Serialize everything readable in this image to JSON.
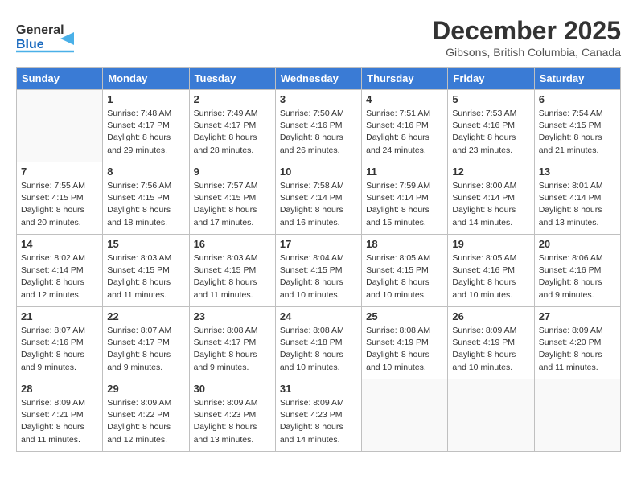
{
  "header": {
    "logo": {
      "line1": "General",
      "line2": "Blue"
    },
    "title": "December 2025",
    "subtitle": "Gibsons, British Columbia, Canada"
  },
  "weekdays": [
    "Sunday",
    "Monday",
    "Tuesday",
    "Wednesday",
    "Thursday",
    "Friday",
    "Saturday"
  ],
  "weeks": [
    [
      {
        "day": "",
        "info": ""
      },
      {
        "day": "1",
        "info": "Sunrise: 7:48 AM\nSunset: 4:17 PM\nDaylight: 8 hours\nand 29 minutes."
      },
      {
        "day": "2",
        "info": "Sunrise: 7:49 AM\nSunset: 4:17 PM\nDaylight: 8 hours\nand 28 minutes."
      },
      {
        "day": "3",
        "info": "Sunrise: 7:50 AM\nSunset: 4:16 PM\nDaylight: 8 hours\nand 26 minutes."
      },
      {
        "day": "4",
        "info": "Sunrise: 7:51 AM\nSunset: 4:16 PM\nDaylight: 8 hours\nand 24 minutes."
      },
      {
        "day": "5",
        "info": "Sunrise: 7:53 AM\nSunset: 4:16 PM\nDaylight: 8 hours\nand 23 minutes."
      },
      {
        "day": "6",
        "info": "Sunrise: 7:54 AM\nSunset: 4:15 PM\nDaylight: 8 hours\nand 21 minutes."
      }
    ],
    [
      {
        "day": "7",
        "info": "Sunrise: 7:55 AM\nSunset: 4:15 PM\nDaylight: 8 hours\nand 20 minutes."
      },
      {
        "day": "8",
        "info": "Sunrise: 7:56 AM\nSunset: 4:15 PM\nDaylight: 8 hours\nand 18 minutes."
      },
      {
        "day": "9",
        "info": "Sunrise: 7:57 AM\nSunset: 4:15 PM\nDaylight: 8 hours\nand 17 minutes."
      },
      {
        "day": "10",
        "info": "Sunrise: 7:58 AM\nSunset: 4:14 PM\nDaylight: 8 hours\nand 16 minutes."
      },
      {
        "day": "11",
        "info": "Sunrise: 7:59 AM\nSunset: 4:14 PM\nDaylight: 8 hours\nand 15 minutes."
      },
      {
        "day": "12",
        "info": "Sunrise: 8:00 AM\nSunset: 4:14 PM\nDaylight: 8 hours\nand 14 minutes."
      },
      {
        "day": "13",
        "info": "Sunrise: 8:01 AM\nSunset: 4:14 PM\nDaylight: 8 hours\nand 13 minutes."
      }
    ],
    [
      {
        "day": "14",
        "info": "Sunrise: 8:02 AM\nSunset: 4:14 PM\nDaylight: 8 hours\nand 12 minutes."
      },
      {
        "day": "15",
        "info": "Sunrise: 8:03 AM\nSunset: 4:15 PM\nDaylight: 8 hours\nand 11 minutes."
      },
      {
        "day": "16",
        "info": "Sunrise: 8:03 AM\nSunset: 4:15 PM\nDaylight: 8 hours\nand 11 minutes."
      },
      {
        "day": "17",
        "info": "Sunrise: 8:04 AM\nSunset: 4:15 PM\nDaylight: 8 hours\nand 10 minutes."
      },
      {
        "day": "18",
        "info": "Sunrise: 8:05 AM\nSunset: 4:15 PM\nDaylight: 8 hours\nand 10 minutes."
      },
      {
        "day": "19",
        "info": "Sunrise: 8:05 AM\nSunset: 4:16 PM\nDaylight: 8 hours\nand 10 minutes."
      },
      {
        "day": "20",
        "info": "Sunrise: 8:06 AM\nSunset: 4:16 PM\nDaylight: 8 hours\nand 9 minutes."
      }
    ],
    [
      {
        "day": "21",
        "info": "Sunrise: 8:07 AM\nSunset: 4:16 PM\nDaylight: 8 hours\nand 9 minutes."
      },
      {
        "day": "22",
        "info": "Sunrise: 8:07 AM\nSunset: 4:17 PM\nDaylight: 8 hours\nand 9 minutes."
      },
      {
        "day": "23",
        "info": "Sunrise: 8:08 AM\nSunset: 4:17 PM\nDaylight: 8 hours\nand 9 minutes."
      },
      {
        "day": "24",
        "info": "Sunrise: 8:08 AM\nSunset: 4:18 PM\nDaylight: 8 hours\nand 10 minutes."
      },
      {
        "day": "25",
        "info": "Sunrise: 8:08 AM\nSunset: 4:19 PM\nDaylight: 8 hours\nand 10 minutes."
      },
      {
        "day": "26",
        "info": "Sunrise: 8:09 AM\nSunset: 4:19 PM\nDaylight: 8 hours\nand 10 minutes."
      },
      {
        "day": "27",
        "info": "Sunrise: 8:09 AM\nSunset: 4:20 PM\nDaylight: 8 hours\nand 11 minutes."
      }
    ],
    [
      {
        "day": "28",
        "info": "Sunrise: 8:09 AM\nSunset: 4:21 PM\nDaylight: 8 hours\nand 11 minutes."
      },
      {
        "day": "29",
        "info": "Sunrise: 8:09 AM\nSunset: 4:22 PM\nDaylight: 8 hours\nand 12 minutes."
      },
      {
        "day": "30",
        "info": "Sunrise: 8:09 AM\nSunset: 4:23 PM\nDaylight: 8 hours\nand 13 minutes."
      },
      {
        "day": "31",
        "info": "Sunrise: 8:09 AM\nSunset: 4:23 PM\nDaylight: 8 hours\nand 14 minutes."
      },
      {
        "day": "",
        "info": ""
      },
      {
        "day": "",
        "info": ""
      },
      {
        "day": "",
        "info": ""
      }
    ]
  ]
}
